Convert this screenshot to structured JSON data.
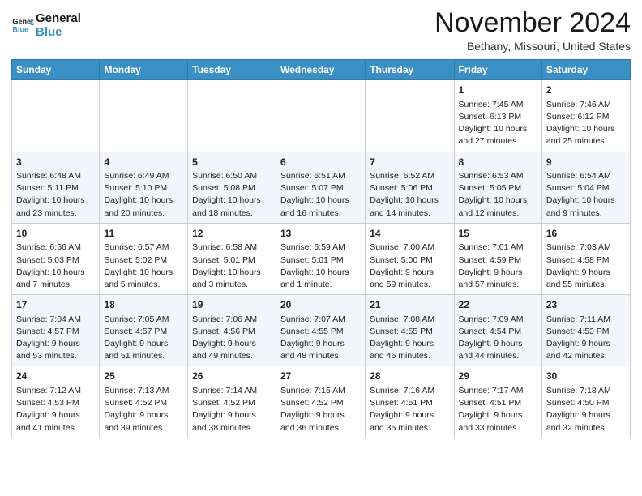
{
  "header": {
    "logo_line1": "General",
    "logo_line2": "Blue",
    "month": "November 2024",
    "location": "Bethany, Missouri, United States"
  },
  "weekdays": [
    "Sunday",
    "Monday",
    "Tuesday",
    "Wednesday",
    "Thursday",
    "Friday",
    "Saturday"
  ],
  "weeks": [
    [
      {
        "day": "",
        "info": ""
      },
      {
        "day": "",
        "info": ""
      },
      {
        "day": "",
        "info": ""
      },
      {
        "day": "",
        "info": ""
      },
      {
        "day": "",
        "info": ""
      },
      {
        "day": "1",
        "info": "Sunrise: 7:45 AM\nSunset: 6:13 PM\nDaylight: 10 hours\nand 27 minutes."
      },
      {
        "day": "2",
        "info": "Sunrise: 7:46 AM\nSunset: 6:12 PM\nDaylight: 10 hours\nand 25 minutes."
      }
    ],
    [
      {
        "day": "3",
        "info": "Sunrise: 6:48 AM\nSunset: 5:11 PM\nDaylight: 10 hours\nand 23 minutes."
      },
      {
        "day": "4",
        "info": "Sunrise: 6:49 AM\nSunset: 5:10 PM\nDaylight: 10 hours\nand 20 minutes."
      },
      {
        "day": "5",
        "info": "Sunrise: 6:50 AM\nSunset: 5:08 PM\nDaylight: 10 hours\nand 18 minutes."
      },
      {
        "day": "6",
        "info": "Sunrise: 6:51 AM\nSunset: 5:07 PM\nDaylight: 10 hours\nand 16 minutes."
      },
      {
        "day": "7",
        "info": "Sunrise: 6:52 AM\nSunset: 5:06 PM\nDaylight: 10 hours\nand 14 minutes."
      },
      {
        "day": "8",
        "info": "Sunrise: 6:53 AM\nSunset: 5:05 PM\nDaylight: 10 hours\nand 12 minutes."
      },
      {
        "day": "9",
        "info": "Sunrise: 6:54 AM\nSunset: 5:04 PM\nDaylight: 10 hours\nand 9 minutes."
      }
    ],
    [
      {
        "day": "10",
        "info": "Sunrise: 6:56 AM\nSunset: 5:03 PM\nDaylight: 10 hours\nand 7 minutes."
      },
      {
        "day": "11",
        "info": "Sunrise: 6:57 AM\nSunset: 5:02 PM\nDaylight: 10 hours\nand 5 minutes."
      },
      {
        "day": "12",
        "info": "Sunrise: 6:58 AM\nSunset: 5:01 PM\nDaylight: 10 hours\nand 3 minutes."
      },
      {
        "day": "13",
        "info": "Sunrise: 6:59 AM\nSunset: 5:01 PM\nDaylight: 10 hours\nand 1 minute."
      },
      {
        "day": "14",
        "info": "Sunrise: 7:00 AM\nSunset: 5:00 PM\nDaylight: 9 hours\nand 59 minutes."
      },
      {
        "day": "15",
        "info": "Sunrise: 7:01 AM\nSunset: 4:59 PM\nDaylight: 9 hours\nand 57 minutes."
      },
      {
        "day": "16",
        "info": "Sunrise: 7:03 AM\nSunset: 4:58 PM\nDaylight: 9 hours\nand 55 minutes."
      }
    ],
    [
      {
        "day": "17",
        "info": "Sunrise: 7:04 AM\nSunset: 4:57 PM\nDaylight: 9 hours\nand 53 minutes."
      },
      {
        "day": "18",
        "info": "Sunrise: 7:05 AM\nSunset: 4:57 PM\nDaylight: 9 hours\nand 51 minutes."
      },
      {
        "day": "19",
        "info": "Sunrise: 7:06 AM\nSunset: 4:56 PM\nDaylight: 9 hours\nand 49 minutes."
      },
      {
        "day": "20",
        "info": "Sunrise: 7:07 AM\nSunset: 4:55 PM\nDaylight: 9 hours\nand 48 minutes."
      },
      {
        "day": "21",
        "info": "Sunrise: 7:08 AM\nSunset: 4:55 PM\nDaylight: 9 hours\nand 46 minutes."
      },
      {
        "day": "22",
        "info": "Sunrise: 7:09 AM\nSunset: 4:54 PM\nDaylight: 9 hours\nand 44 minutes."
      },
      {
        "day": "23",
        "info": "Sunrise: 7:11 AM\nSunset: 4:53 PM\nDaylight: 9 hours\nand 42 minutes."
      }
    ],
    [
      {
        "day": "24",
        "info": "Sunrise: 7:12 AM\nSunset: 4:53 PM\nDaylight: 9 hours\nand 41 minutes."
      },
      {
        "day": "25",
        "info": "Sunrise: 7:13 AM\nSunset: 4:52 PM\nDaylight: 9 hours\nand 39 minutes."
      },
      {
        "day": "26",
        "info": "Sunrise: 7:14 AM\nSunset: 4:52 PM\nDaylight: 9 hours\nand 38 minutes."
      },
      {
        "day": "27",
        "info": "Sunrise: 7:15 AM\nSunset: 4:52 PM\nDaylight: 9 hours\nand 36 minutes."
      },
      {
        "day": "28",
        "info": "Sunrise: 7:16 AM\nSunset: 4:51 PM\nDaylight: 9 hours\nand 35 minutes."
      },
      {
        "day": "29",
        "info": "Sunrise: 7:17 AM\nSunset: 4:51 PM\nDaylight: 9 hours\nand 33 minutes."
      },
      {
        "day": "30",
        "info": "Sunrise: 7:18 AM\nSunset: 4:50 PM\nDaylight: 9 hours\nand 32 minutes."
      }
    ]
  ]
}
